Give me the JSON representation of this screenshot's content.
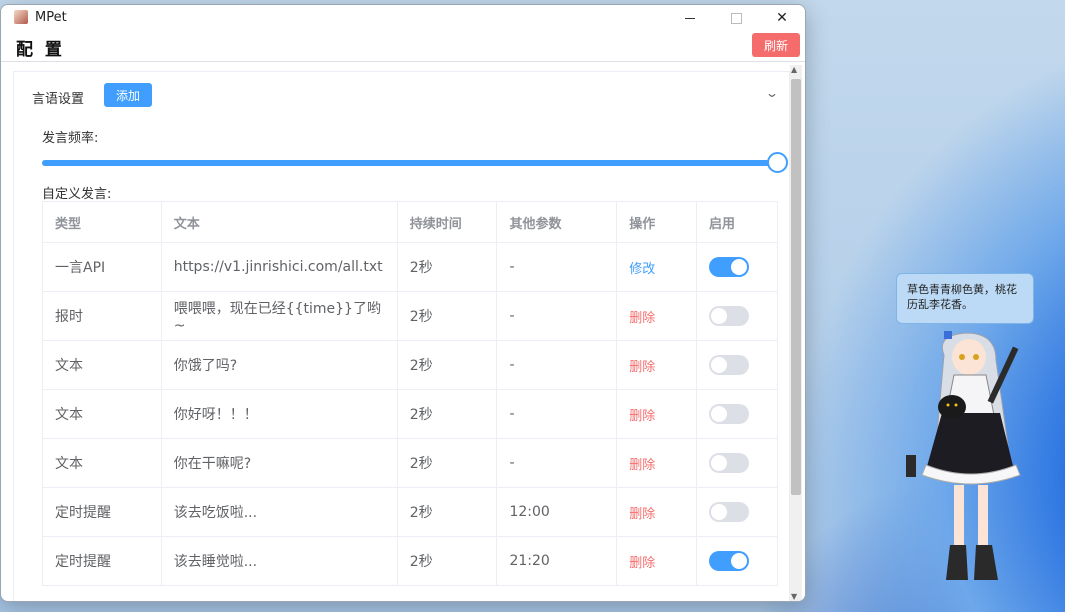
{
  "window": {
    "app_title": "MPet"
  },
  "header": {
    "title": "配 置",
    "refresh_label": "刷新"
  },
  "section": {
    "title": "言语设置",
    "add_label": "添加"
  },
  "frequency": {
    "label": "发言频率:",
    "value_fraction": 1.0
  },
  "custom": {
    "label": "自定义发言:"
  },
  "table": {
    "headers": [
      "类型",
      "文本",
      "持续时间",
      "其他参数",
      "操作",
      "启用"
    ],
    "rows": [
      {
        "type": "一言API",
        "text": "https://v1.jinrishici.com/all.txt",
        "duration": "2秒",
        "params": "-",
        "action": "修改",
        "enabled": true
      },
      {
        "type": "报时",
        "text": "喂喂喂，现在已经{{time}}了哟~",
        "duration": "2秒",
        "params": "-",
        "action": "删除",
        "enabled": false
      },
      {
        "type": "文本",
        "text": "你饿了吗?",
        "duration": "2秒",
        "params": "-",
        "action": "删除",
        "enabled": false
      },
      {
        "type": "文本",
        "text": "你好呀！！！",
        "duration": "2秒",
        "params": "-",
        "action": "删除",
        "enabled": false
      },
      {
        "type": "文本",
        "text": "你在干嘛呢?",
        "duration": "2秒",
        "params": "-",
        "action": "删除",
        "enabled": false
      },
      {
        "type": "定时提醒",
        "text": "该去吃饭啦...",
        "duration": "2秒",
        "params": "12:00",
        "action": "删除",
        "enabled": false
      },
      {
        "type": "定时提醒",
        "text": "该去睡觉啦...",
        "duration": "2秒",
        "params": "21:20",
        "action": "删除",
        "enabled": true
      }
    ]
  },
  "pet": {
    "speech": "草色青青柳色黄，桃花历乱李花香。"
  },
  "colors": {
    "primary": "#409eff",
    "danger": "#f56c6c",
    "switch_off": "#dcdfe6"
  }
}
